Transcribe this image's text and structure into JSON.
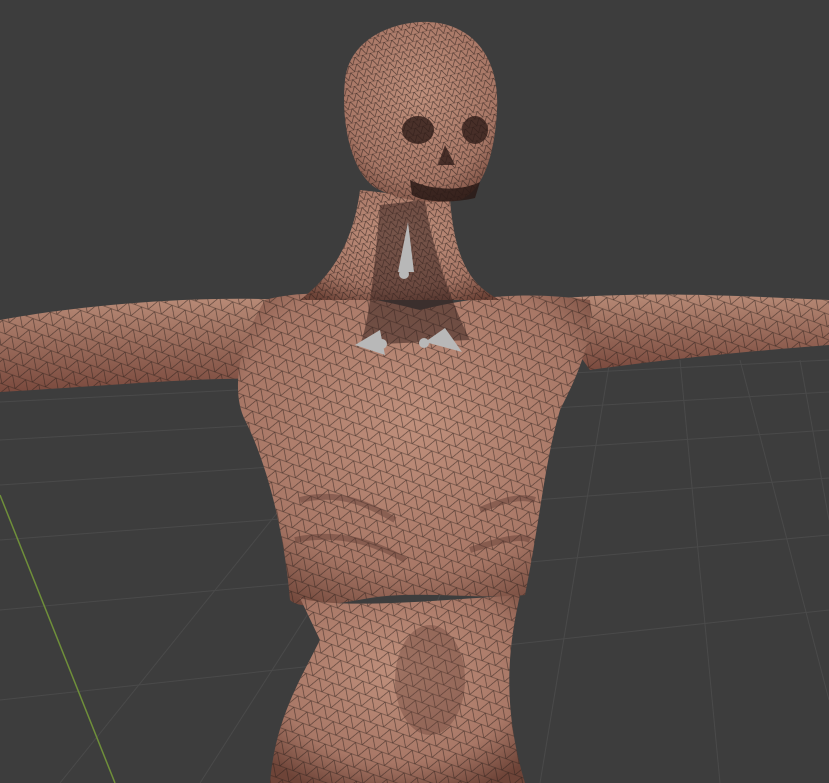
{
  "viewport": {
    "background_color": "#3d3d3d",
    "grid_color": "#4a4a4a",
    "y_axis_color": "#6f8f3a"
  },
  "model": {
    "skin_color": "#b08270",
    "skin_shadow_color": "#5e3a32",
    "wire_color": "#2a1e1a"
  },
  "bones": {
    "color": "#b8b8b8",
    "items": [
      "neck-bone",
      "left-clavicle-bone",
      "right-clavicle-bone"
    ]
  }
}
